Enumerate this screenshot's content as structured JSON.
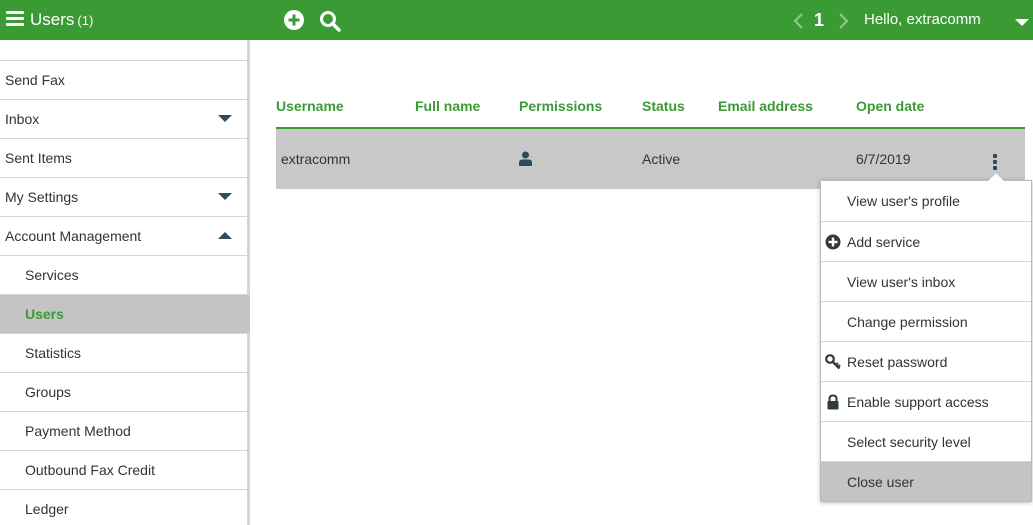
{
  "header": {
    "title": "Users",
    "count": "(1)",
    "page_number": "1",
    "greeting": "Hello, extracomm",
    "brand_color": "#3a9b34"
  },
  "sidebar": {
    "items": [
      {
        "label": "Send Fax"
      },
      {
        "label": "Inbox"
      },
      {
        "label": "Sent Items"
      },
      {
        "label": "My Settings"
      },
      {
        "label": "Account Management"
      },
      {
        "label": "Services"
      },
      {
        "label": "Users"
      },
      {
        "label": "Statistics"
      },
      {
        "label": "Groups"
      },
      {
        "label": "Payment Method"
      },
      {
        "label": "Outbound Fax Credit"
      },
      {
        "label": "Ledger"
      }
    ]
  },
  "table": {
    "columns": [
      "Username",
      "Full name",
      "Permissions",
      "Status",
      "Email address",
      "Open date"
    ],
    "rows": [
      {
        "username": "extracomm",
        "full_name": "",
        "permissions_icon": "user-icon",
        "status": "Active",
        "email": "",
        "open_date": "6/7/2019"
      }
    ]
  },
  "context_menu": {
    "items": [
      {
        "label": "View user's profile",
        "icon": ""
      },
      {
        "label": "Add service",
        "icon": "plus-circle-icon"
      },
      {
        "label": "View user's inbox",
        "icon": ""
      },
      {
        "label": "Change permission",
        "icon": ""
      },
      {
        "label": "Reset password",
        "icon": "key-icon"
      },
      {
        "label": "Enable support access",
        "icon": "lock-icon"
      },
      {
        "label": "Select security level",
        "icon": ""
      },
      {
        "label": "Close user",
        "icon": ""
      }
    ]
  }
}
